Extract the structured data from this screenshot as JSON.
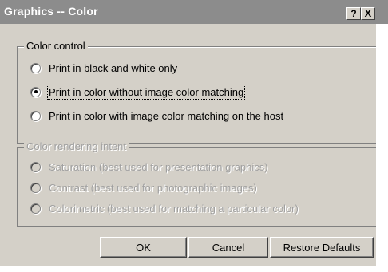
{
  "window": {
    "title": "Graphics -- Color",
    "help_icon_glyph": "?",
    "close_icon_glyph": "X"
  },
  "color_control": {
    "label": "Color control",
    "options": [
      {
        "label": "Print in black and white only",
        "selected": false
      },
      {
        "label": "Print in color without image color matching",
        "selected": true
      },
      {
        "label": "Print in color with image color matching on the host",
        "selected": false
      }
    ]
  },
  "rendering_intent": {
    "label": "Color rendering intent",
    "enabled": false,
    "options": [
      {
        "label": "Saturation (best used for presentation graphics)"
      },
      {
        "label": "Contrast (best used for photographic images)"
      },
      {
        "label": "Colorimetric (best used for matching a particular color)"
      }
    ]
  },
  "buttons": {
    "ok": "OK",
    "cancel": "Cancel",
    "restore": "Restore Defaults"
  },
  "colors": {
    "dialog_bg": "#d4d0c8",
    "titlebar_bg": "#8c8c8c",
    "disabled_text": "#a0a0a0"
  }
}
